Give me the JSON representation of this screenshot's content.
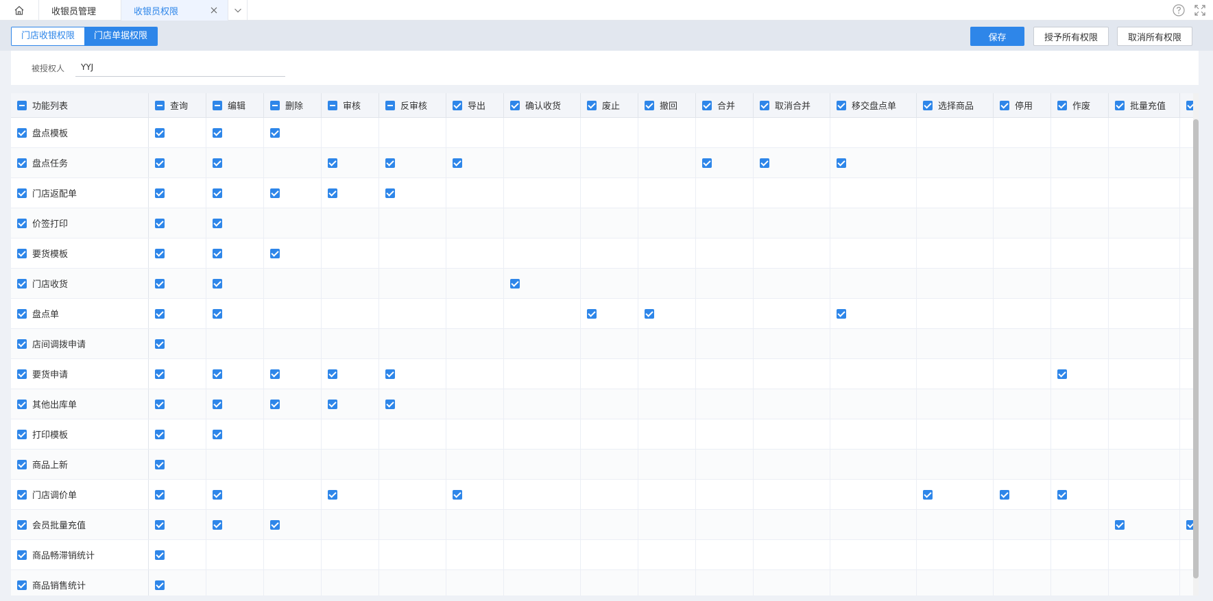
{
  "tabs": [
    {
      "label": "收银员管理"
    },
    {
      "label": "收银员权限",
      "active": true
    }
  ],
  "toolbar": {
    "segments": [
      "门店收银权限",
      "门店单据权限"
    ],
    "active_segment": 1,
    "save_label": "保存",
    "grant_all_label": "授予所有权限",
    "revoke_all_label": "取消所有权限"
  },
  "grantee": {
    "label": "被授权人",
    "value": "YYJ"
  },
  "colors": {
    "accent": "#2e86e9"
  },
  "table": {
    "first_header": "功能列表",
    "columns": [
      {
        "label": "查询",
        "state": "indeterminate"
      },
      {
        "label": "编辑",
        "state": "indeterminate"
      },
      {
        "label": "删除",
        "state": "indeterminate"
      },
      {
        "label": "审核",
        "state": "indeterminate"
      },
      {
        "label": "反审核",
        "state": "indeterminate"
      },
      {
        "label": "导出",
        "state": "checked"
      },
      {
        "label": "确认收货",
        "state": "checked"
      },
      {
        "label": "废止",
        "state": "checked"
      },
      {
        "label": "撤回",
        "state": "checked"
      },
      {
        "label": "合并",
        "state": "checked"
      },
      {
        "label": "取消合并",
        "state": "checked"
      },
      {
        "label": "移交盘点单",
        "state": "checked"
      },
      {
        "label": "选择商品",
        "state": "checked"
      },
      {
        "label": "停用",
        "state": "checked"
      },
      {
        "label": "作废",
        "state": "checked"
      },
      {
        "label": "批量充值",
        "state": "checked"
      },
      {
        "label": "",
        "state": "checked"
      }
    ],
    "rows": [
      {
        "label": "盘点模板",
        "checked": [
          0,
          1,
          2
        ]
      },
      {
        "label": "盘点任务",
        "checked": [
          0,
          1,
          3,
          4,
          5,
          9,
          10,
          11
        ]
      },
      {
        "label": "门店返配单",
        "checked": [
          0,
          1,
          2,
          3,
          4
        ]
      },
      {
        "label": "价签打印",
        "checked": [
          0,
          1
        ]
      },
      {
        "label": "要货模板",
        "checked": [
          0,
          1,
          2
        ]
      },
      {
        "label": "门店收货",
        "checked": [
          0,
          1,
          6
        ]
      },
      {
        "label": "盘点单",
        "checked": [
          0,
          1,
          7,
          8,
          11
        ]
      },
      {
        "label": "店间调拨申请",
        "checked": [
          0
        ]
      },
      {
        "label": "要货申请",
        "checked": [
          0,
          1,
          2,
          3,
          4,
          14
        ]
      },
      {
        "label": "其他出库单",
        "checked": [
          0,
          1,
          2,
          3,
          4
        ]
      },
      {
        "label": "打印模板",
        "checked": [
          0,
          1
        ]
      },
      {
        "label": "商品上新",
        "checked": [
          0
        ]
      },
      {
        "label": "门店调价单",
        "checked": [
          0,
          1,
          3,
          5,
          12,
          13,
          14
        ]
      },
      {
        "label": "会员批量充值",
        "checked": [
          0,
          1,
          2,
          15,
          16
        ]
      },
      {
        "label": "商品畅滞销统计",
        "checked": [
          0
        ]
      },
      {
        "label": "商品销售统计",
        "checked": [
          0
        ]
      }
    ]
  }
}
